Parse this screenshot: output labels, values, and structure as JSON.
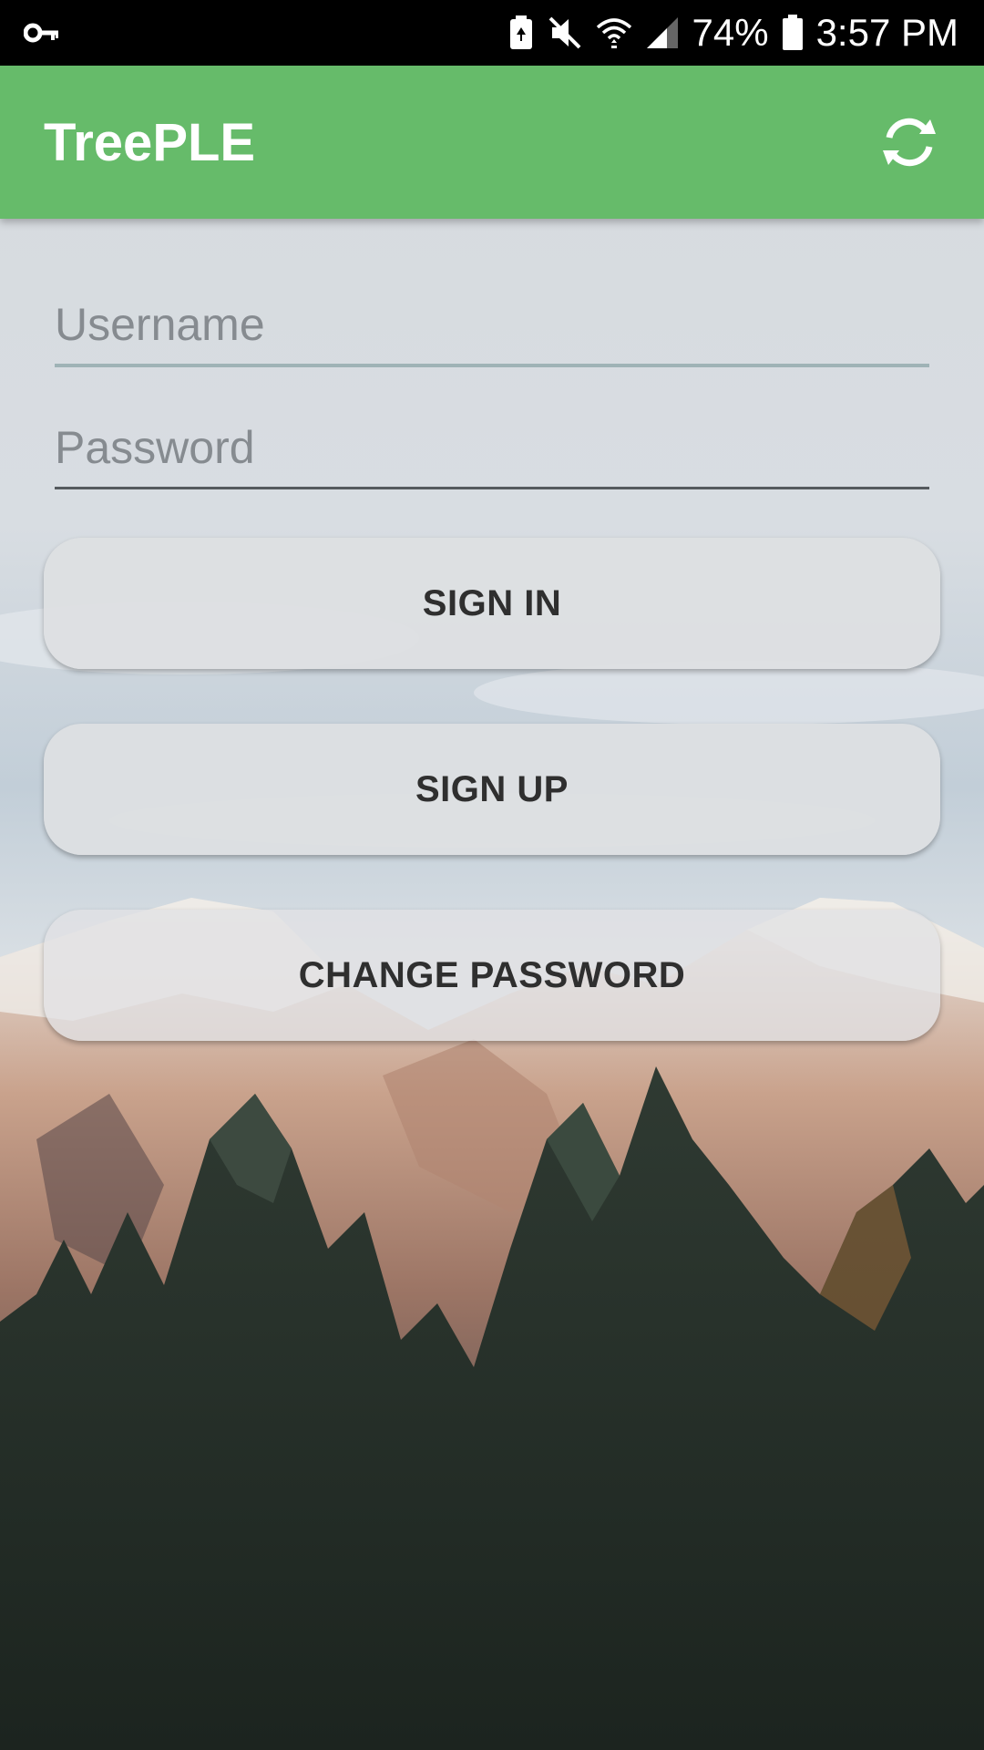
{
  "status_bar": {
    "icons": [
      "key-icon",
      "battery-saver-icon",
      "mute-icon",
      "wifi-icon",
      "cell-signal-icon",
      "battery-icon"
    ],
    "battery_percent": "74%",
    "time": "3:57 PM"
  },
  "app_bar": {
    "title": "TreePLE",
    "action_icon": "refresh-icon",
    "color": "#66bb6a"
  },
  "form": {
    "username": {
      "value": "",
      "placeholder": "Username"
    },
    "password": {
      "value": "",
      "placeholder": "Password"
    }
  },
  "buttons": {
    "sign_in": "SIGN IN",
    "sign_up": "SIGN UP",
    "change_password": "CHANGE PASSWORD"
  },
  "background": {
    "description_icon": "mountain-forest-background"
  }
}
